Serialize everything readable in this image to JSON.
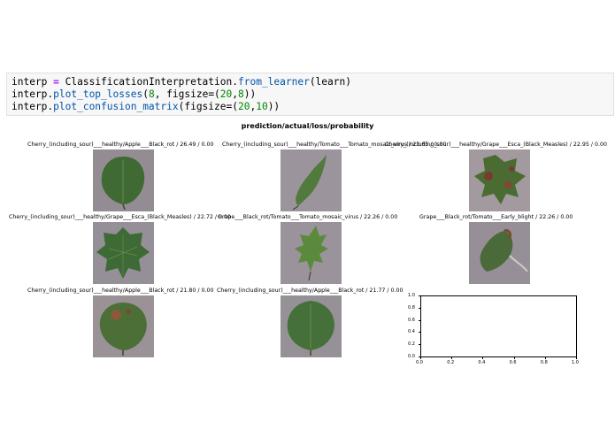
{
  "code_cell": {
    "line1": {
      "a": "interp ",
      "op": "=",
      "b": " ClassificationInterpretation.",
      "attr": "from_learner",
      "c": "(learn)"
    },
    "line2": {
      "a": "interp.",
      "attr": "plot_top_losses",
      "c1": "(",
      "n1": "8",
      "c2": ", figsize=(",
      "n2": "20",
      "c3": ",",
      "n3": "8",
      "c4": "))"
    },
    "line3": {
      "a": "interp.",
      "attr": "plot_confusion_matrix",
      "c1": "(figsize=(",
      "n1": "20",
      "c2": ",",
      "n2": "10",
      "c3": "))"
    }
  },
  "figure": {
    "title": "prediction/actual/loss/probability",
    "images": [
      {
        "caption": "Cherry_(including_sour)___healthy/Apple___Black_rot / 26.49 / 0.00",
        "leaf_color": "#3f6a33",
        "bg_color": "#938c93"
      },
      {
        "caption": "Cherry_(including_sour)___healthy/Tomato___Tomato_mosaic_virus / 23.65 / 0.00",
        "leaf_color": "#527a3c",
        "bg_color": "#9b949d"
      },
      {
        "caption": "Cherry_(including_sour)___healthy/Grape___Esca_(Black_Measles) / 22.95 / 0.00",
        "leaf_color": "#4a6b32",
        "bg_color": "#a29a9f"
      },
      {
        "caption": "Cherry_(including_sour)___healthy/Grape___Esca_(Black_Measles) / 22.72 / 0.00",
        "leaf_color": "#3d6a35",
        "bg_color": "#958f97"
      },
      {
        "caption": "Grape___Black_rot/Tomato___Tomato_mosaic_virus / 22.26 / 0.00",
        "leaf_color": "#5c8a3c",
        "bg_color": "#9a939b"
      },
      {
        "caption": "Grape___Black_rot/Tomato___Early_blight / 22.26 / 0.00",
        "leaf_color": "#4a6a3a",
        "bg_color": "#968f98"
      },
      {
        "caption": "Cherry_(including_sour)___healthy/Apple___Black_rot / 21.80 / 0.00",
        "leaf_color": "#4b6f37",
        "bg_color": "#9a9296"
      },
      {
        "caption": "Cherry_(including_sour)___healthy/Apple___Black_rot / 21.77 / 0.00",
        "leaf_color": "#46703a",
        "bg_color": "#969097"
      }
    ],
    "empty_axes": {
      "x_ticks": [
        "0.0",
        "0.2",
        "0.4",
        "0.6",
        "0.8",
        "1.0"
      ],
      "y_ticks": [
        "0.0",
        "0.2",
        "0.4",
        "0.6",
        "0.8",
        "1.0"
      ]
    }
  }
}
